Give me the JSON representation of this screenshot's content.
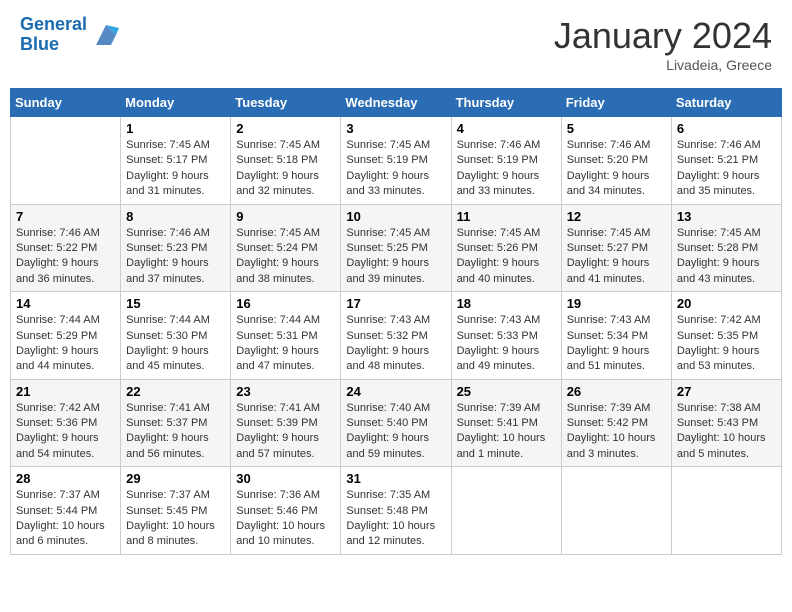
{
  "header": {
    "logo_line1": "General",
    "logo_line2": "Blue",
    "month": "January 2024",
    "location": "Livadeia, Greece"
  },
  "days_of_week": [
    "Sunday",
    "Monday",
    "Tuesday",
    "Wednesday",
    "Thursday",
    "Friday",
    "Saturday"
  ],
  "weeks": [
    [
      {
        "day": "",
        "content": ""
      },
      {
        "day": "1",
        "content": "Sunrise: 7:45 AM\nSunset: 5:17 PM\nDaylight: 9 hours and 31 minutes."
      },
      {
        "day": "2",
        "content": "Sunrise: 7:45 AM\nSunset: 5:18 PM\nDaylight: 9 hours and 32 minutes."
      },
      {
        "day": "3",
        "content": "Sunrise: 7:45 AM\nSunset: 5:19 PM\nDaylight: 9 hours and 33 minutes."
      },
      {
        "day": "4",
        "content": "Sunrise: 7:46 AM\nSunset: 5:19 PM\nDaylight: 9 hours and 33 minutes."
      },
      {
        "day": "5",
        "content": "Sunrise: 7:46 AM\nSunset: 5:20 PM\nDaylight: 9 hours and 34 minutes."
      },
      {
        "day": "6",
        "content": "Sunrise: 7:46 AM\nSunset: 5:21 PM\nDaylight: 9 hours and 35 minutes."
      }
    ],
    [
      {
        "day": "7",
        "content": "Sunrise: 7:46 AM\nSunset: 5:22 PM\nDaylight: 9 hours and 36 minutes."
      },
      {
        "day": "8",
        "content": "Sunrise: 7:46 AM\nSunset: 5:23 PM\nDaylight: 9 hours and 37 minutes."
      },
      {
        "day": "9",
        "content": "Sunrise: 7:45 AM\nSunset: 5:24 PM\nDaylight: 9 hours and 38 minutes."
      },
      {
        "day": "10",
        "content": "Sunrise: 7:45 AM\nSunset: 5:25 PM\nDaylight: 9 hours and 39 minutes."
      },
      {
        "day": "11",
        "content": "Sunrise: 7:45 AM\nSunset: 5:26 PM\nDaylight: 9 hours and 40 minutes."
      },
      {
        "day": "12",
        "content": "Sunrise: 7:45 AM\nSunset: 5:27 PM\nDaylight: 9 hours and 41 minutes."
      },
      {
        "day": "13",
        "content": "Sunrise: 7:45 AM\nSunset: 5:28 PM\nDaylight: 9 hours and 43 minutes."
      }
    ],
    [
      {
        "day": "14",
        "content": "Sunrise: 7:44 AM\nSunset: 5:29 PM\nDaylight: 9 hours and 44 minutes."
      },
      {
        "day": "15",
        "content": "Sunrise: 7:44 AM\nSunset: 5:30 PM\nDaylight: 9 hours and 45 minutes."
      },
      {
        "day": "16",
        "content": "Sunrise: 7:44 AM\nSunset: 5:31 PM\nDaylight: 9 hours and 47 minutes."
      },
      {
        "day": "17",
        "content": "Sunrise: 7:43 AM\nSunset: 5:32 PM\nDaylight: 9 hours and 48 minutes."
      },
      {
        "day": "18",
        "content": "Sunrise: 7:43 AM\nSunset: 5:33 PM\nDaylight: 9 hours and 49 minutes."
      },
      {
        "day": "19",
        "content": "Sunrise: 7:43 AM\nSunset: 5:34 PM\nDaylight: 9 hours and 51 minutes."
      },
      {
        "day": "20",
        "content": "Sunrise: 7:42 AM\nSunset: 5:35 PM\nDaylight: 9 hours and 53 minutes."
      }
    ],
    [
      {
        "day": "21",
        "content": "Sunrise: 7:42 AM\nSunset: 5:36 PM\nDaylight: 9 hours and 54 minutes."
      },
      {
        "day": "22",
        "content": "Sunrise: 7:41 AM\nSunset: 5:37 PM\nDaylight: 9 hours and 56 minutes."
      },
      {
        "day": "23",
        "content": "Sunrise: 7:41 AM\nSunset: 5:39 PM\nDaylight: 9 hours and 57 minutes."
      },
      {
        "day": "24",
        "content": "Sunrise: 7:40 AM\nSunset: 5:40 PM\nDaylight: 9 hours and 59 minutes."
      },
      {
        "day": "25",
        "content": "Sunrise: 7:39 AM\nSunset: 5:41 PM\nDaylight: 10 hours and 1 minute."
      },
      {
        "day": "26",
        "content": "Sunrise: 7:39 AM\nSunset: 5:42 PM\nDaylight: 10 hours and 3 minutes."
      },
      {
        "day": "27",
        "content": "Sunrise: 7:38 AM\nSunset: 5:43 PM\nDaylight: 10 hours and 5 minutes."
      }
    ],
    [
      {
        "day": "28",
        "content": "Sunrise: 7:37 AM\nSunset: 5:44 PM\nDaylight: 10 hours and 6 minutes."
      },
      {
        "day": "29",
        "content": "Sunrise: 7:37 AM\nSunset: 5:45 PM\nDaylight: 10 hours and 8 minutes."
      },
      {
        "day": "30",
        "content": "Sunrise: 7:36 AM\nSunset: 5:46 PM\nDaylight: 10 hours and 10 minutes."
      },
      {
        "day": "31",
        "content": "Sunrise: 7:35 AM\nSunset: 5:48 PM\nDaylight: 10 hours and 12 minutes."
      },
      {
        "day": "",
        "content": ""
      },
      {
        "day": "",
        "content": ""
      },
      {
        "day": "",
        "content": ""
      }
    ]
  ]
}
